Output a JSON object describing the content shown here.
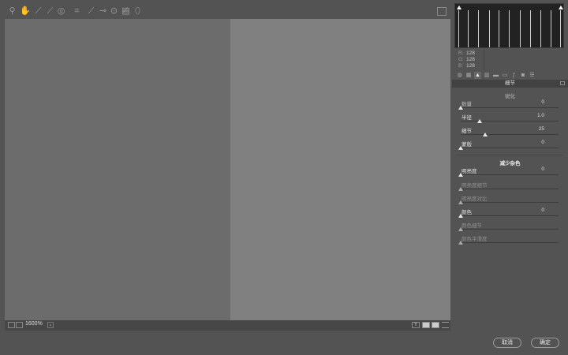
{
  "toolbar": {
    "tools": [
      "zoom-icon",
      "hand-icon",
      "white-balance-icon",
      "color-sampler-icon",
      "targeted-adjustment-icon",
      "crop-icon",
      "straighten-icon",
      "spot-removal-icon",
      "red-eye-icon",
      "adjustment-brush-icon",
      "graduated-filter-icon",
      "radial-filter-icon"
    ],
    "right_icon": "open-preferences-icon"
  },
  "canvas": {
    "left_color": "#6c6c6c",
    "right_color": "#808080"
  },
  "statusbar": {
    "zoom": "1600%",
    "view_buttons": [
      "Y",
      "before-after-icon",
      "swap-icon",
      "list-icon"
    ]
  },
  "rgb": {
    "r_label": "R:",
    "r": "128",
    "g_label": "G:",
    "g": "128",
    "b_label": "B:",
    "b": "128"
  },
  "panel_tabs": [
    "basic",
    "tone-curve",
    "detail",
    "hsl",
    "split-toning",
    "lens",
    "fx",
    "camera",
    "presets"
  ],
  "detail": {
    "title": "细节",
    "sharpening": {
      "heading": "锐化",
      "sliders": [
        {
          "label": "数量",
          "value": "0",
          "pos": 0.0
        },
        {
          "label": "半径",
          "value": "1.0",
          "pos": 0.19
        },
        {
          "label": "细节",
          "value": "25",
          "pos": 0.25
        },
        {
          "label": "蒙版",
          "value": "0",
          "pos": 0.0
        }
      ]
    },
    "noise_reduction": {
      "heading": "减少杂色",
      "sliders": [
        {
          "label": "明亮度",
          "value": "0",
          "pos": 0.0,
          "enabled": true
        },
        {
          "label": "明亮度细节",
          "value": "",
          "pos": 0.0,
          "enabled": false
        },
        {
          "label": "明亮度对比",
          "value": "",
          "pos": 0.0,
          "enabled": false
        },
        {
          "label": "颜色",
          "value": "0",
          "pos": 0.0,
          "enabled": true
        },
        {
          "label": "颜色细节",
          "value": "",
          "pos": 0.0,
          "enabled": false
        },
        {
          "label": "颜色平滑度",
          "value": "",
          "pos": 0.0,
          "enabled": false
        }
      ]
    }
  },
  "buttons": {
    "cancel": "取消",
    "ok": "确定"
  }
}
